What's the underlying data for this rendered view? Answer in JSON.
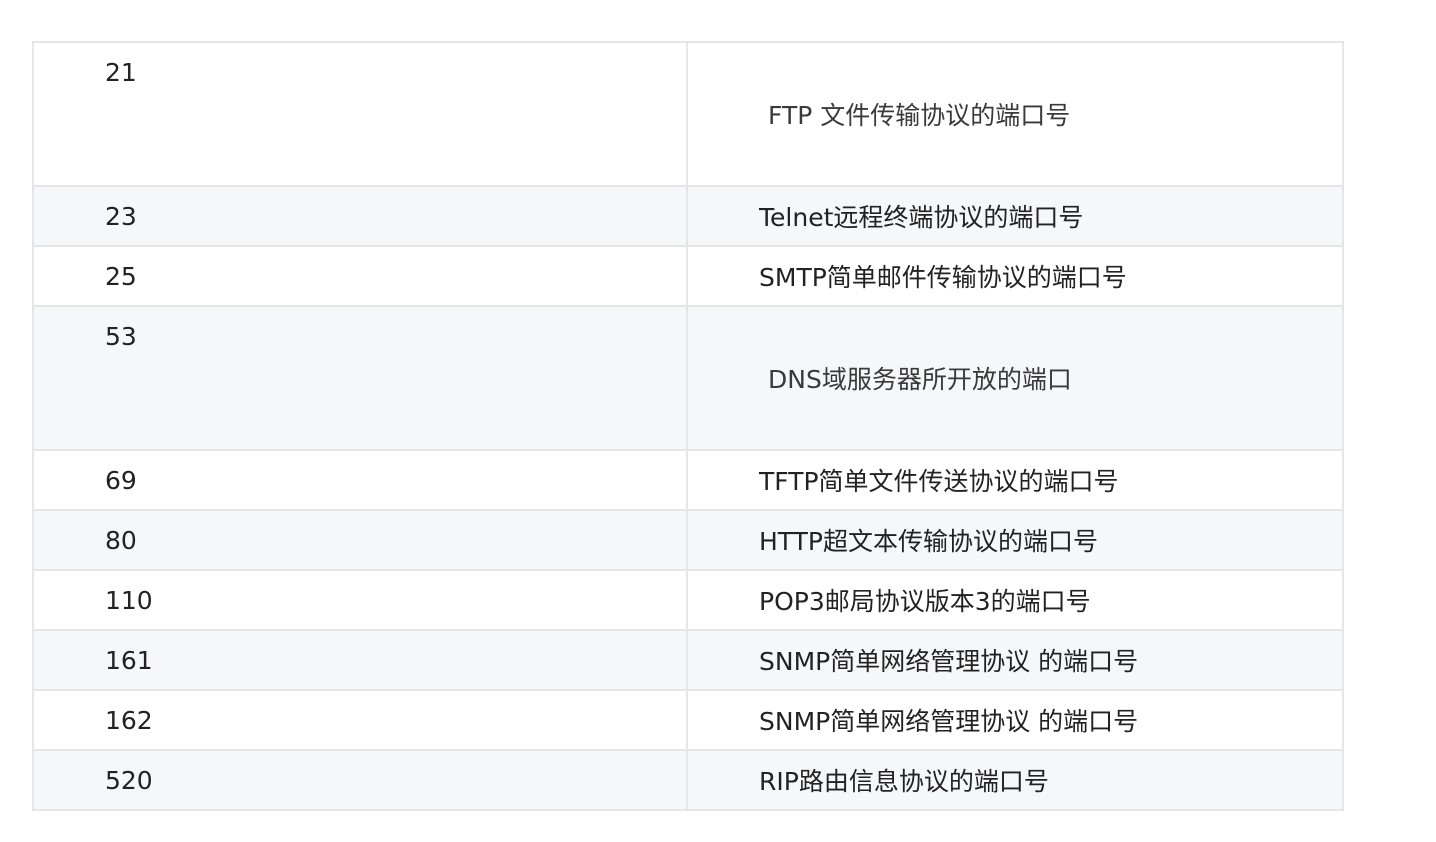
{
  "table": {
    "rows": [
      {
        "port": "21",
        "description": "FTP 文件传输协议的端口号"
      },
      {
        "port": "23",
        "description": "Telnet远程终端协议的端口号"
      },
      {
        "port": "25",
        "description": "SMTP简单邮件传输协议的端口号"
      },
      {
        "port": "53",
        "description": "DNS域服务器所开放的端口"
      },
      {
        "port": "69",
        "description": "TFTP简单文件传送协议的端口号"
      },
      {
        "port": "80",
        "description": "HTTP超文本传输协议的端口号"
      },
      {
        "port": "110",
        "description": "POP3邮局协议版本3的端口号"
      },
      {
        "port": "161",
        "description": "SNMP简单网络管理协议 的端口号"
      },
      {
        "port": "162",
        "description": "SNMP简单网络管理协议 的端口号"
      },
      {
        "port": "520",
        "description": "RIP路由信息协议的端口号"
      }
    ]
  }
}
